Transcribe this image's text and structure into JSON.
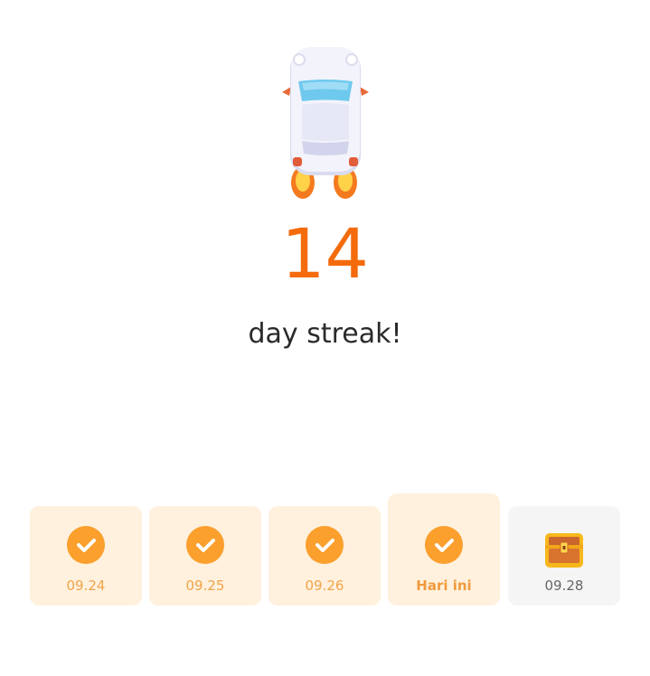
{
  "streak": {
    "count": "14",
    "label": "day streak!"
  },
  "days": [
    {
      "label": "09.24",
      "status": "done"
    },
    {
      "label": "09.25",
      "status": "done"
    },
    {
      "label": "09.26",
      "status": "done"
    },
    {
      "label": "Hari ini",
      "status": "done-today"
    },
    {
      "label": "09.28",
      "status": "reward"
    }
  ],
  "colors": {
    "accent": "#f46b0c",
    "check": "#fb9f2d",
    "card_done": "#fff1dd",
    "card_future": "#f5f5f5"
  },
  "icons": {
    "hero": "rocket-car-icon",
    "done": "check-circle-icon",
    "reward": "treasure-chest-icon"
  }
}
